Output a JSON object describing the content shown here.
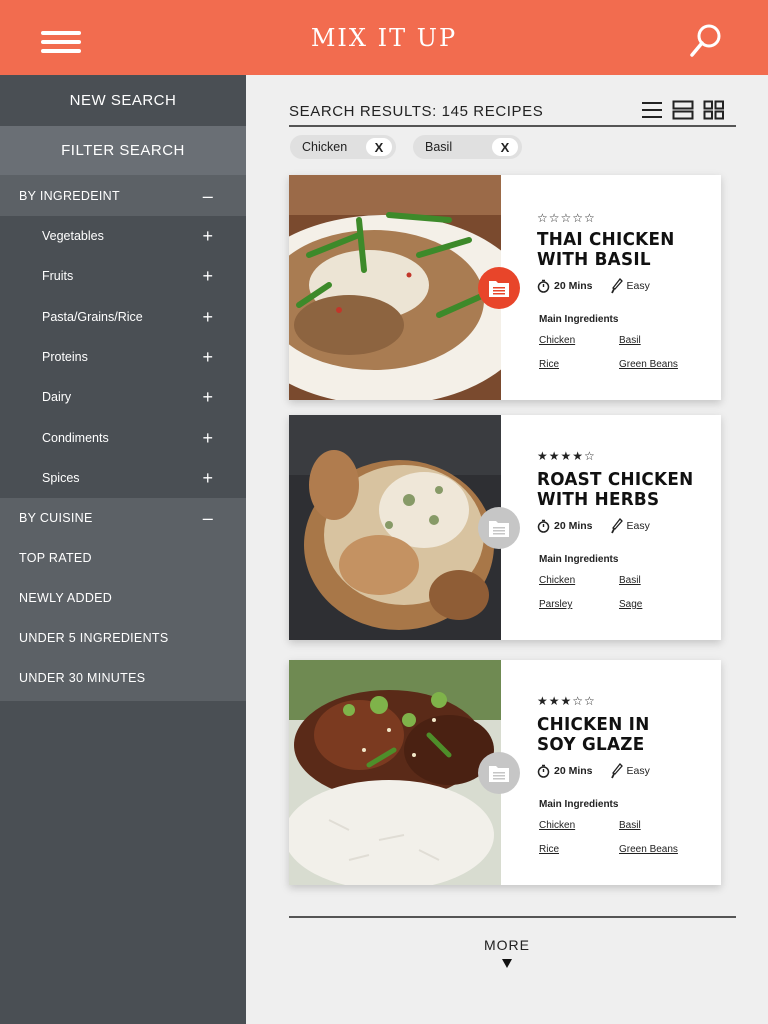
{
  "app": {
    "title": "MIX IT UP"
  },
  "sidebar": {
    "new_search": "NEW SEARCH",
    "filter_search": "FILTER SEARCH",
    "by_ingredient": {
      "label": "BY INGREDEINT",
      "toggle": "–"
    },
    "ingredient_items": [
      {
        "label": "Vegetables",
        "toggle": "+"
      },
      {
        "label": "Fruits",
        "toggle": "+"
      },
      {
        "label": "Pasta/Grains/Rice",
        "toggle": "+"
      },
      {
        "label": "Proteins",
        "toggle": "+"
      },
      {
        "label": "Dairy",
        "toggle": "+"
      },
      {
        "label": "Condiments",
        "toggle": "+"
      },
      {
        "label": "Spices",
        "toggle": "+"
      }
    ],
    "by_cuisine": {
      "label": "BY CUISINE",
      "toggle": "–"
    },
    "other_filters": [
      "TOP RATED",
      "NEWLY ADDED",
      "UNDER 5 INGREDIENTS",
      "UNDER 30 MINUTES"
    ]
  },
  "results": {
    "title": "SEARCH RESULTS: 145 RECIPES",
    "view_options": [
      "list-view-icon",
      "large-list-view-icon",
      "grid-view-icon"
    ],
    "chips": [
      {
        "label": "Chicken",
        "remove": "X"
      },
      {
        "label": "Basil",
        "remove": "X"
      }
    ],
    "recipes": [
      {
        "stars": "☆☆☆☆☆",
        "title_line1": "THAI CHICKEN",
        "title_line2": "WITH BASIL",
        "time": "20 Mins",
        "difficulty": "Easy",
        "saved": true,
        "ingredients_label": "Main Ingredients",
        "ingredients": [
          "Chicken",
          "Basil",
          "Rice",
          "Green Beans"
        ]
      },
      {
        "stars": "★★★★☆",
        "title_line1": "ROAST CHICKEN",
        "title_line2": "WITH HERBS",
        "time": "20 Mins",
        "difficulty": "Easy",
        "saved": false,
        "ingredients_label": "Main Ingredients",
        "ingredients": [
          "Chicken",
          "Basil",
          "Parsley",
          "Sage"
        ]
      },
      {
        "stars": "★★★☆☆",
        "title_line1": "CHICKEN IN",
        "title_line2": "SOY GLAZE",
        "time": "20 Mins",
        "difficulty": "Easy",
        "saved": false,
        "ingredients_label": "Main Ingredients",
        "ingredients": [
          "Chicken",
          "Basil",
          "Rice",
          "Green Beans"
        ]
      }
    ],
    "more_label": "MORE"
  },
  "colors": {
    "header": "#f26c4f",
    "sidebar": "#4a4f54",
    "sidebar_highlight": "#5c6166",
    "save_active": "#e8452a",
    "save_inactive": "#c6c6c6"
  }
}
